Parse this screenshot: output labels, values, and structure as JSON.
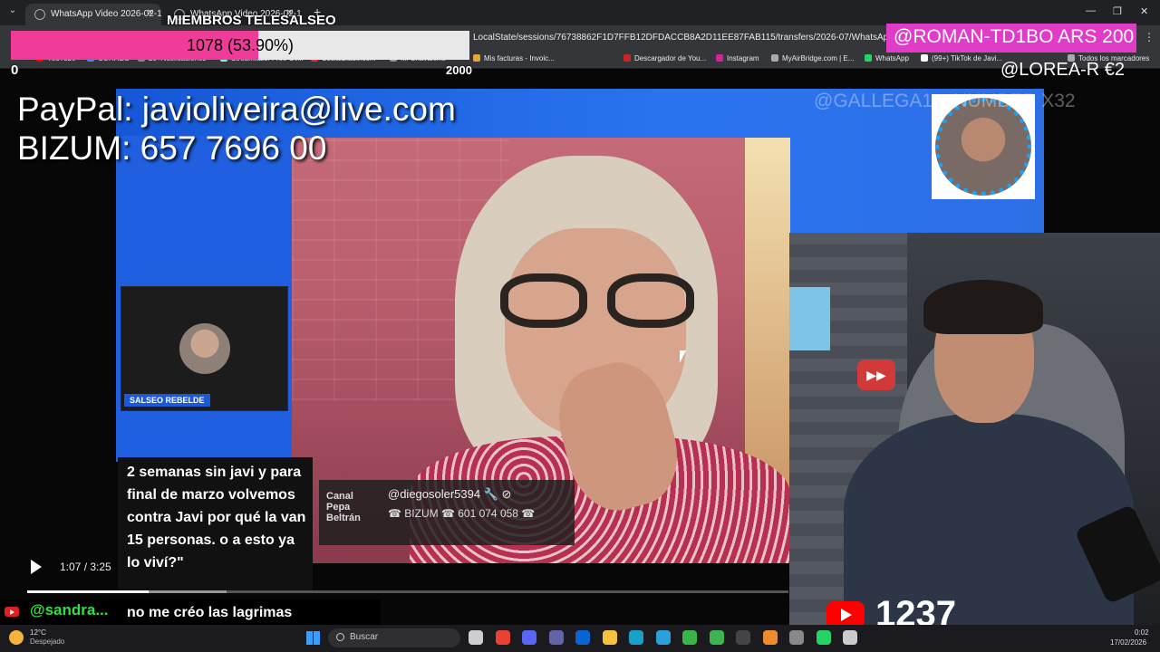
{
  "browser": {
    "tabs": [
      {
        "label": "WhatsApp Video 2026-02-16 a"
      },
      {
        "label": "WhatsApp Video 2026-02-16 a"
      }
    ],
    "url": "LocalState/sessions/76738862F1D7FFB12DFDACCB8A2D11EE87FAB115/transfers/2026-07/WhatsApp%20Video",
    "bookmarks": [
      {
        "label": "YouTube",
        "color": "#ff0000"
      },
      {
        "label": "CORREO",
        "color": "#4285f4"
      },
      {
        "label": "20+Notificaciones",
        "color": "#888888"
      },
      {
        "label": "Streamlabs: Free Ov...",
        "color": "#80f5d2"
      },
      {
        "label": "SocialBlade.com",
        "color": "#d33"
      },
      {
        "label": "Mi Chavalería",
        "color": "#999"
      },
      {
        "label": "Mis facturas - Invoic...",
        "color": "#e8a33d"
      },
      {
        "label": "Descargador de You...",
        "color": "#c22"
      },
      {
        "label": "Instagram",
        "color": "#d6249f"
      },
      {
        "label": "MyAirBridge.com | E...",
        "color": "#aaa"
      },
      {
        "label": "WhatsApp",
        "color": "#25d366"
      },
      {
        "label": "(99+) TikTok de Javi...",
        "color": "#ffffff"
      },
      {
        "label": "Todos los marcadores",
        "color": "#aaa"
      }
    ]
  },
  "overlay": {
    "members_title": "MIEMBROS TELESALSEO",
    "members_text": "1078 (53.90%)",
    "members_progress": 0.539,
    "members_min": "0",
    "members_max": "2000",
    "paypal": "PayPal: javioliveira@live.com",
    "bizum": "BIZUM: 657 7696 00",
    "donor_top": "@ROMAN-TD1BO  ARS 200",
    "donor_second": "@LOREA-R  €2",
    "donor_ghost": "@GALLEGA1... NUMBER X32",
    "pink_color": "#ee3c98",
    "donor_color": "#e13cc7"
  },
  "video": {
    "pip_label": "SALSEO REBELDE",
    "sticker_logo": "Canal Pepa Beltrán",
    "sticker_handle": "@diegosoler5394 🔧 ⊘",
    "sticker_bizum": "☎ BIZUM ☎ 601 074 058 ☎",
    "subtitle": "2 semanas sin javi y para final de marzo volvemos contra Javi por qué la van 15 personas. o a esto ya lo viví?\"",
    "time": "1:07 / 3:25",
    "played_fraction": 0.34,
    "cam_logo": "▶▶"
  },
  "chat": {
    "user": "@sandra...",
    "message": "no me créo las lagrimas de la Pepa",
    "subscriber_count": "1237"
  },
  "taskbar": {
    "weather_temp": "12°C",
    "weather_desc": "Despejado",
    "search_placeholder": "Buscar",
    "time": "0:02",
    "date": "17/02/2026",
    "apps": [
      {
        "name": "task-view-icon",
        "color": "#cfcfcf"
      },
      {
        "name": "chrome-icon",
        "color": "#e94235"
      },
      {
        "name": "discord-icon",
        "color": "#5865f2"
      },
      {
        "name": "teams-icon",
        "color": "#6264a7"
      },
      {
        "name": "outlook-icon",
        "color": "#0a64d2"
      },
      {
        "name": "file-explorer-icon",
        "color": "#f6c23e"
      },
      {
        "name": "edge-icon",
        "color": "#1aa0c8"
      },
      {
        "name": "telegram-icon",
        "color": "#2aa1da"
      },
      {
        "name": "globe-icon",
        "color": "#39b54a"
      },
      {
        "name": "camtasia-icon",
        "color": "#3fb34f"
      },
      {
        "name": "obs-icon",
        "color": "#444444"
      },
      {
        "name": "brave-icon",
        "color": "#f28a30"
      },
      {
        "name": "app-icon",
        "color": "#888888"
      },
      {
        "name": "whatsapp-icon",
        "color": "#25d366"
      },
      {
        "name": "screen-icon",
        "color": "#cccccc"
      }
    ]
  }
}
